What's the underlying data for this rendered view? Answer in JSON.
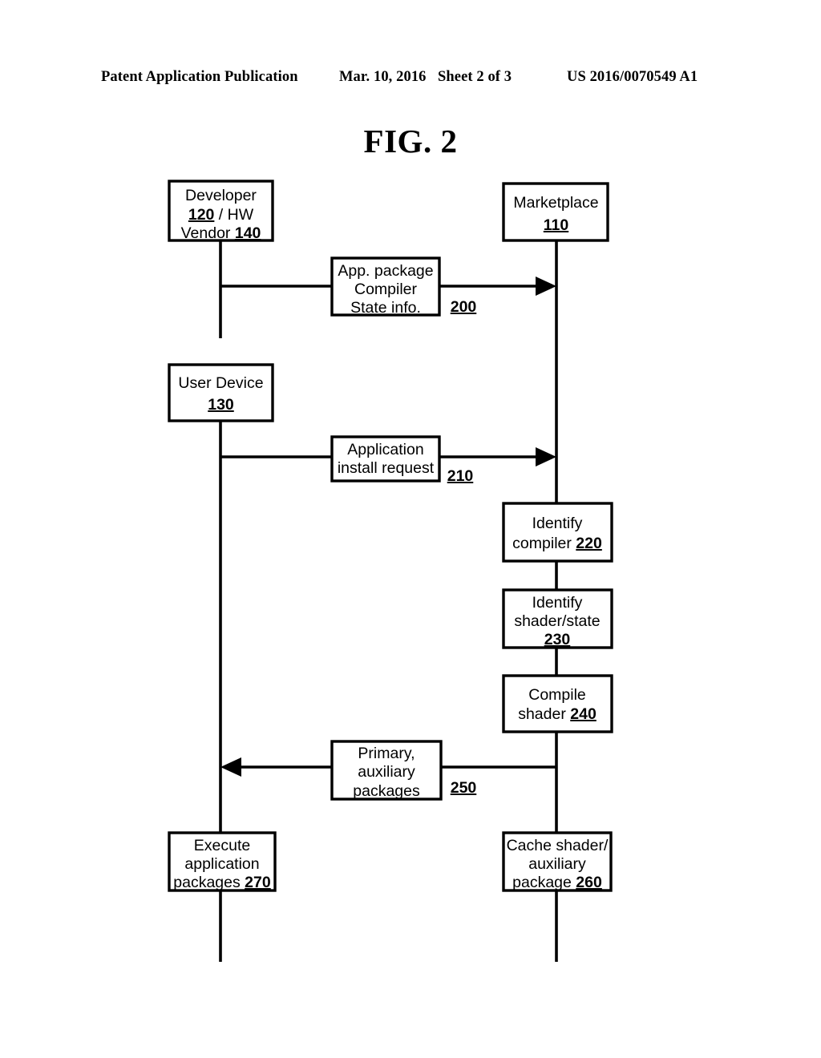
{
  "header": {
    "publication": "Patent Application Publication",
    "date": "Mar. 10, 2016",
    "sheet": "Sheet 2 of 3",
    "document_number": "US 2016/0070549 A1"
  },
  "figure": {
    "title": "FIG. 2",
    "type": "sequence-diagram",
    "ink_color": "#000000",
    "background_color": "#ffffff"
  },
  "actors": [
    {
      "id": "developer",
      "lines": [
        "Developer",
        "120 / HW",
        "Vendor 140"
      ],
      "line1": "Developer",
      "line2_ref": "120",
      "line2_rest": " / HW",
      "line3_text": "Vendor ",
      "line3_ref": "140"
    },
    {
      "id": "marketplace",
      "line1": "Marketplace",
      "line2_ref": "110"
    },
    {
      "id": "user-device",
      "line1": "User Device",
      "line2_ref": "130"
    }
  ],
  "messages": [
    {
      "id": "msg-200",
      "line1": "App. package",
      "line2": "Compiler",
      "line3": "State info.",
      "ref": "200",
      "direction": "developer-to-marketplace"
    },
    {
      "id": "msg-210",
      "line1": "Application",
      "line2": "install request",
      "ref": "210",
      "direction": "user-device-to-marketplace"
    },
    {
      "id": "msg-250",
      "line1": "Primary,",
      "line2": "auxiliary",
      "line3": "packages",
      "ref": "250",
      "direction": "marketplace-to-user-device"
    }
  ],
  "process_steps": [
    {
      "id": "step-220",
      "line1": "Identify",
      "line2_text": "compiler ",
      "line2_ref": "220",
      "lane": "marketplace"
    },
    {
      "id": "step-230",
      "line1": "Identify",
      "line2": "shader/state",
      "line3_ref": "230",
      "lane": "marketplace"
    },
    {
      "id": "step-240",
      "line1": "Compile",
      "line2_text": "shader ",
      "line2_ref": "240",
      "lane": "marketplace"
    },
    {
      "id": "step-260",
      "line1": "Cache shader/",
      "line2": "auxiliary",
      "line3_text": "package ",
      "line3_ref": "260",
      "lane": "marketplace"
    },
    {
      "id": "step-270",
      "line1": "Execute",
      "line2": "application",
      "line3_text": "packages ",
      "line3_ref": "270",
      "lane": "user-device"
    }
  ]
}
